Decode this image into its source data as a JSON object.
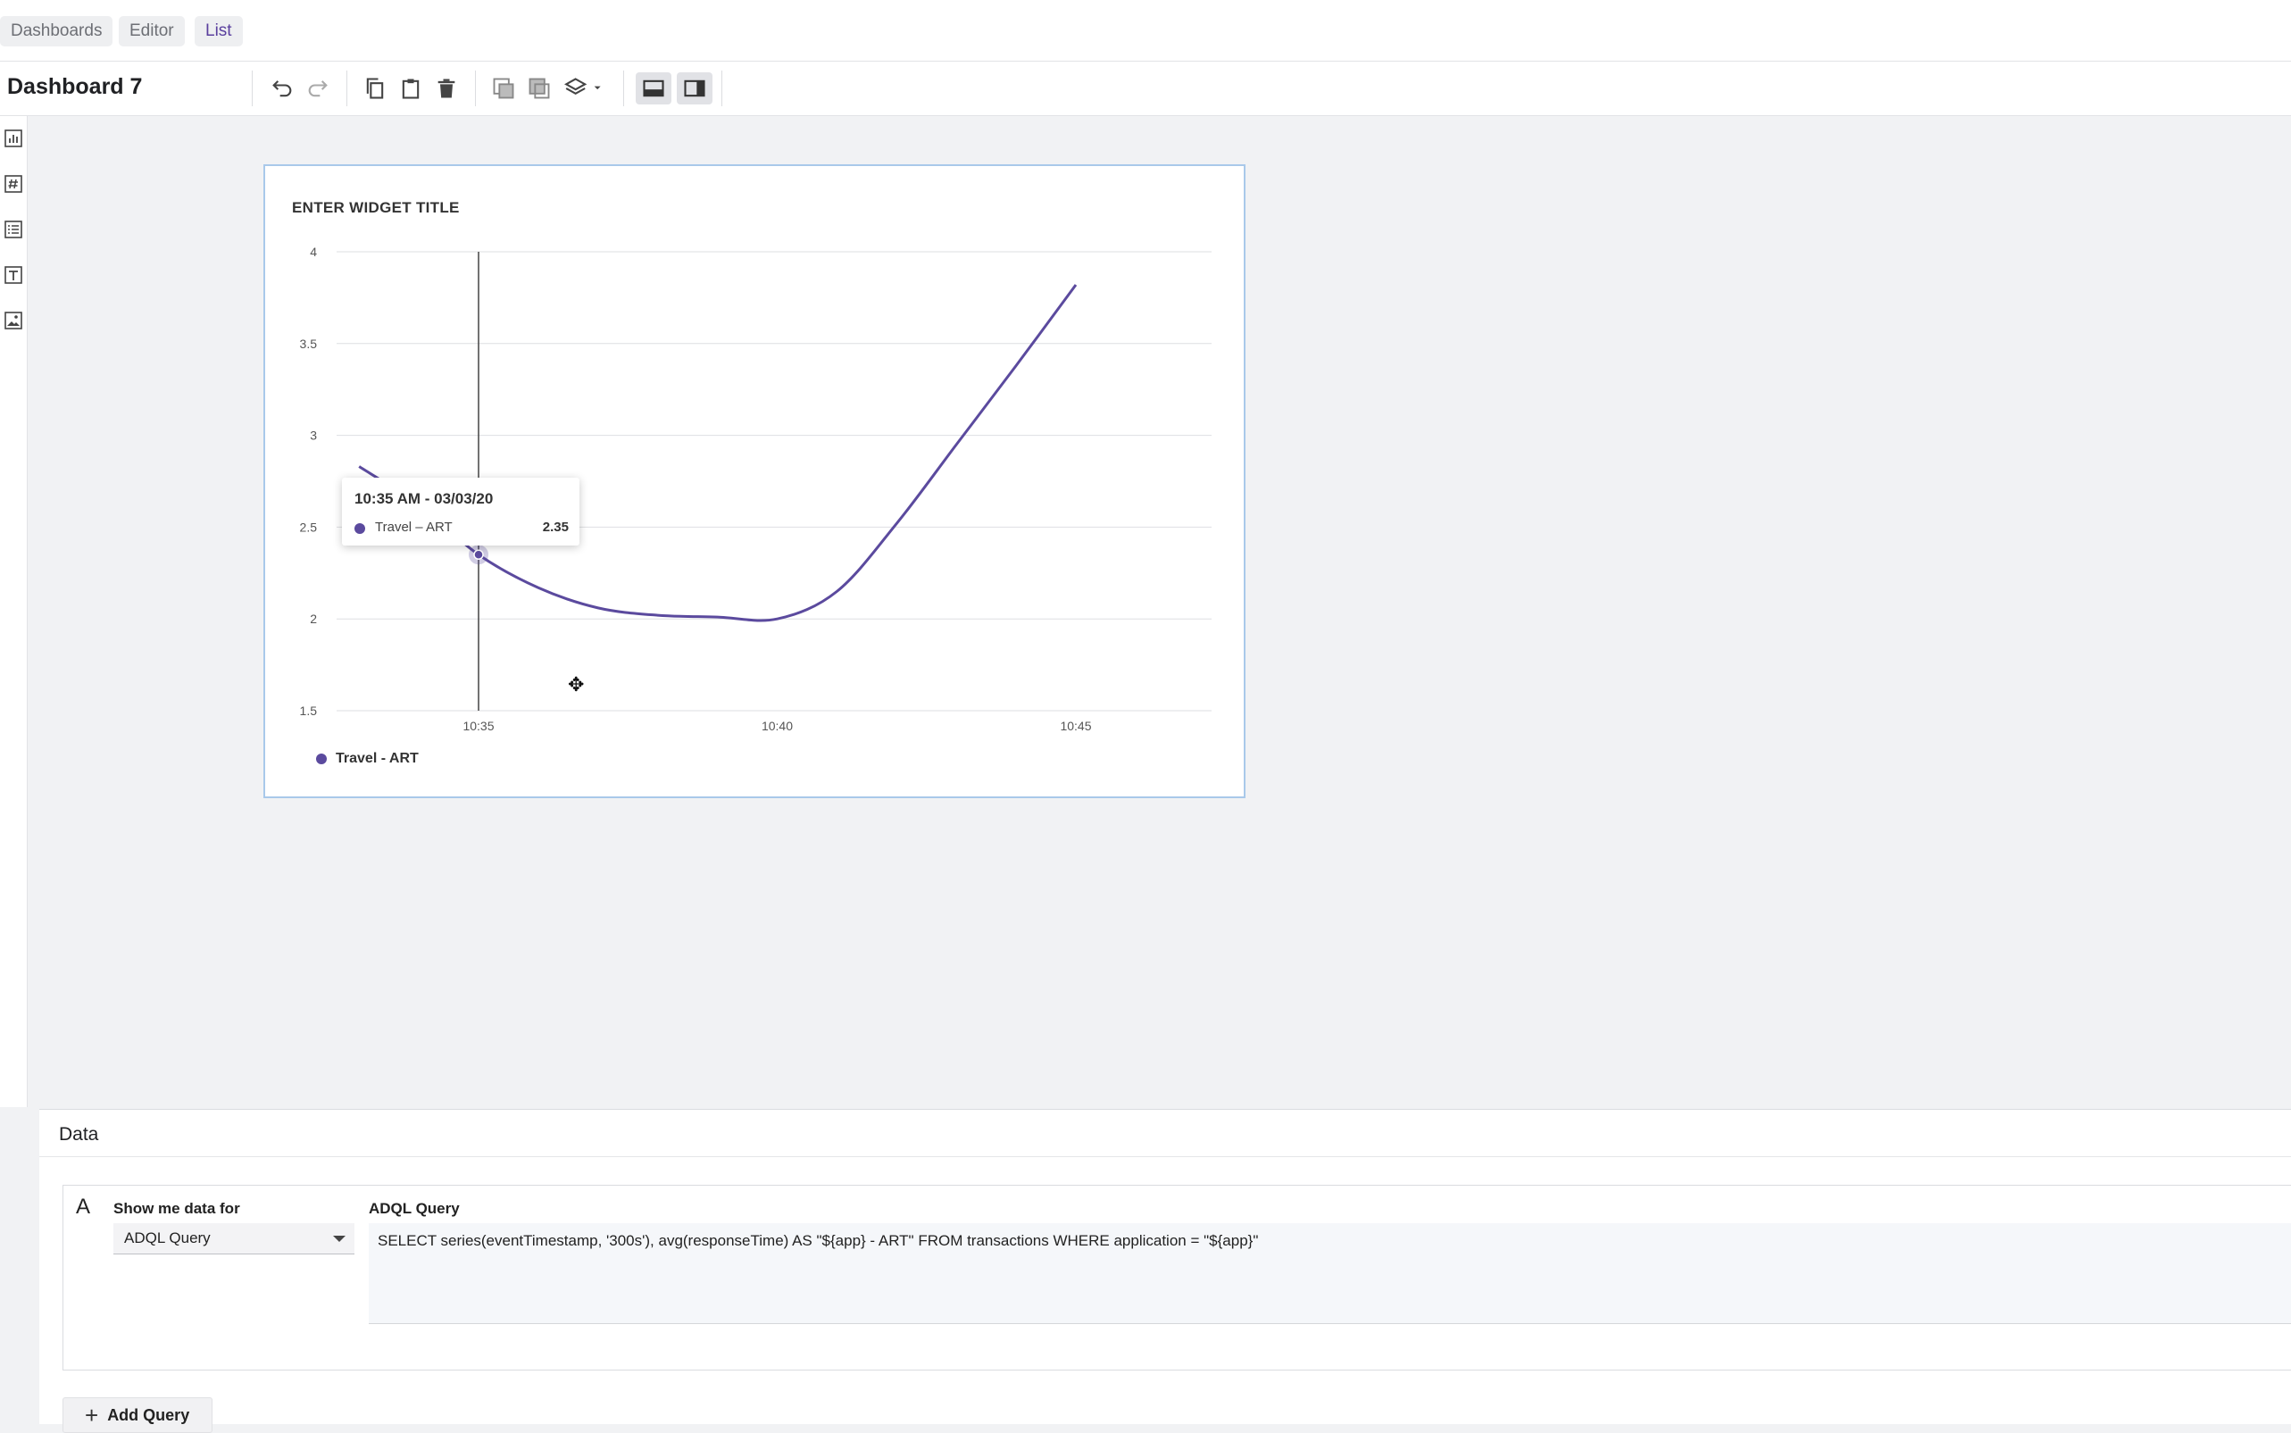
{
  "nav": {
    "tabs": [
      {
        "label": "Dashboards"
      },
      {
        "label": "Editor"
      },
      {
        "label": "List"
      }
    ]
  },
  "toolbar": {
    "title": "Dashboard 7",
    "icons": [
      "undo-icon",
      "redo-icon",
      "copy-icon",
      "paste-icon",
      "delete-icon",
      "bring-forward-icon",
      "send-backward-icon",
      "layers-icon",
      "layout-full-icon",
      "layout-split-icon"
    ]
  },
  "rail": {
    "icons": [
      "chart-widget-icon",
      "number-widget-icon",
      "list-widget-icon",
      "text-widget-icon",
      "image-widget-icon"
    ]
  },
  "widget": {
    "title": "ENTER WIDGET TITLE",
    "tooltip": {
      "time": "10:35 AM - 03/03/20",
      "series": "Travel – ART",
      "value": "2.35"
    },
    "legend": {
      "label": "Travel - ART"
    }
  },
  "chart_data": {
    "type": "line",
    "title": "ENTER WIDGET TITLE",
    "x": [
      "10:33",
      "10:34",
      "10:35",
      "10:36",
      "10:37",
      "10:38",
      "10:39",
      "10:40",
      "10:41",
      "10:42",
      "10:43",
      "10:44",
      "10:45"
    ],
    "xticks": [
      "10:35",
      "10:40",
      "10:45"
    ],
    "series": [
      {
        "name": "Travel - ART",
        "color": "#5b4a9e",
        "values": [
          2.83,
          2.62,
          2.35,
          2.17,
          2.06,
          2.02,
          2.01,
          2.0,
          2.15,
          2.52,
          2.95,
          3.38,
          3.82
        ]
      }
    ],
    "yticks": [
      "4",
      "3.5",
      "3",
      "2.5",
      "2",
      "1.5"
    ],
    "ylim": [
      1.5,
      4
    ],
    "grid": true,
    "legend": "bottom-left",
    "hover": {
      "x": "10:35",
      "value": 2.35
    }
  },
  "data_panel": {
    "title": "Data",
    "query": {
      "letter": "A",
      "show_label": "Show me data for",
      "source_value": "ADQL Query",
      "adql_label": "ADQL Query",
      "adql_text": "SELECT series(eventTimestamp, '300s'), avg(responseTime) AS \"${app} - ART\" FROM transactions WHERE application = \"${app}\""
    },
    "add_query_label": "Add Query"
  },
  "colors": {
    "accent": "#5b4a9e",
    "selection_border": "#a9c9ea"
  }
}
